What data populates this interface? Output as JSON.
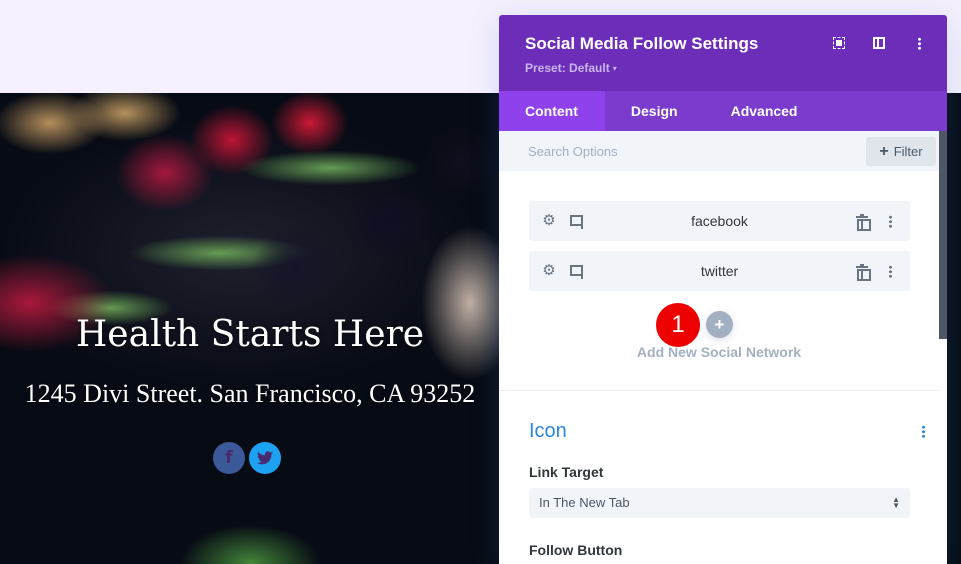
{
  "preview": {
    "title": "Health Starts Here",
    "address": "1245 Divi Street. San Francisco, CA 93252",
    "social_icons": [
      {
        "network": "facebook",
        "glyph": "f",
        "color": "#3b5998"
      },
      {
        "network": "twitter",
        "glyph": "🐦",
        "color": "#1da1f2"
      }
    ]
  },
  "panel": {
    "title": "Social Media Follow Settings",
    "preset_label": "Preset: Default",
    "preset_caret": "▾",
    "header_icons": [
      "expand-icon",
      "split-view-icon",
      "more-options-icon"
    ],
    "colors": {
      "header": "#6c2eb9",
      "tabs": "#7b3ccd",
      "active_tab": "#8f42ec",
      "accent": "#2b87da"
    },
    "tabs": [
      {
        "label": "Content",
        "active": true
      },
      {
        "label": "Design",
        "active": false
      },
      {
        "label": "Advanced",
        "active": false
      }
    ],
    "search": {
      "placeholder": "Search Options",
      "value": ""
    },
    "filter_label": "Filter",
    "filter_plus": "+",
    "networks": [
      {
        "label": "facebook"
      },
      {
        "label": "twitter"
      }
    ],
    "add_button_glyph": "+",
    "add_label": "Add New Social Network",
    "step_badge": "1",
    "section": {
      "title": "Icon",
      "link_target_label": "Link Target",
      "link_target_value": "In The New Tab",
      "follow_button_label": "Follow Button"
    }
  }
}
